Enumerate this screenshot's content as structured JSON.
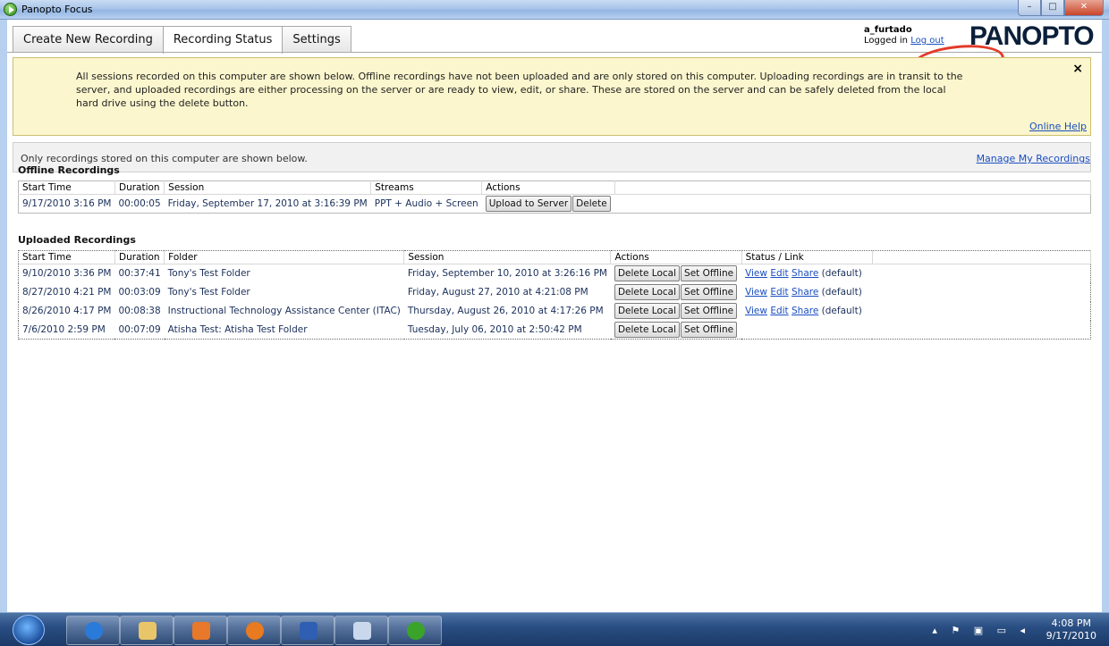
{
  "window": {
    "title": "Panopto Focus",
    "minimize": "–",
    "maximize": "□",
    "close": "✕"
  },
  "tabs": [
    {
      "label": "Create New Recording"
    },
    {
      "label": "Recording Status"
    },
    {
      "label": "Settings"
    }
  ],
  "user": {
    "name": "a_furtado",
    "logged_in_text": "Logged in",
    "logout": "Log out"
  },
  "logo": "PANOPTO",
  "banner": {
    "text": "All sessions recorded on this computer are shown below.  Offline recordings have not been uploaded and are only stored on this computer.  Uploading recordings are in transit to the server, and uploaded recordings are either processing on the server or are ready to view, edit, or share.  These are stored on the server and can be safely deleted from the local hard drive using the delete button.",
    "close": "×",
    "help": "Online Help"
  },
  "notice": {
    "text": "Only recordings stored on this computer are shown below.",
    "manage": "Manage My Recordings"
  },
  "offline": {
    "title": "Offline Recordings",
    "headers": [
      "Start Time",
      "Duration",
      "Session",
      "Streams",
      "Actions"
    ],
    "rows": [
      {
        "start": "9/17/2010 3:16 PM",
        "duration": "00:00:05",
        "session": "Friday, September 17, 2010 at 3:16:39 PM",
        "streams": "PPT + Audio + Screen",
        "upload": "Upload to Server",
        "delete": "Delete"
      }
    ]
  },
  "uploaded": {
    "title": "Uploaded Recordings",
    "headers": [
      "Start Time",
      "Duration",
      "Folder",
      "Session",
      "Actions",
      "Status / Link"
    ],
    "rows": [
      {
        "start": "9/10/2010 3:36 PM",
        "duration": "00:37:41",
        "folder": "Tony's Test Folder",
        "session": "Friday, September 10, 2010 at 3:26:16 PM",
        "delete_local": "Delete Local",
        "set_offline": "Set Offline",
        "view": "View",
        "edit": "Edit",
        "share": "Share",
        "status": "(default)"
      },
      {
        "start": "8/27/2010 4:21 PM",
        "duration": "00:03:09",
        "folder": "Tony's Test Folder",
        "session": "Friday, August 27, 2010 at 4:21:08 PM",
        "delete_local": "Delete Local",
        "set_offline": "Set Offline",
        "view": "View",
        "edit": "Edit",
        "share": "Share",
        "status": "(default)"
      },
      {
        "start": "8/26/2010 4:17 PM",
        "duration": "00:08:38",
        "folder": "Instructional Technology Assistance Center (ITAC)",
        "session": "Thursday, August 26, 2010 at 4:17:26 PM",
        "delete_local": "Delete Local",
        "set_offline": "Set Offline",
        "view": "View",
        "edit": "Edit",
        "share": "Share",
        "status": "(default)"
      },
      {
        "start": "7/6/2010 2:59 PM",
        "duration": "00:07:09",
        "folder": "Atisha Test: Atisha Test Folder",
        "session": "Tuesday, July 06, 2010 at 2:50:42 PM",
        "delete_local": "Delete Local",
        "set_offline": "Set Offline",
        "view": "",
        "edit": "",
        "share": "",
        "status": ""
      }
    ]
  },
  "taskbar": {
    "items": [
      "internet-explorer-icon",
      "file-explorer-icon",
      "media-player-icon",
      "firefox-icon",
      "word-icon",
      "paint-icon",
      "panopto-icon"
    ],
    "time": "4:08 PM",
    "date": "9/17/2010"
  }
}
